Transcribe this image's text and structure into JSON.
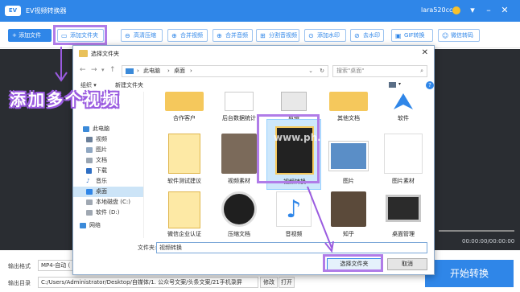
{
  "app": {
    "title": "EV视频转换器",
    "logo": "EV",
    "username": "lara520cc",
    "accent_color": "#2f86e8"
  },
  "toolbar": {
    "add_file": "+ 添加文件",
    "add_folder": "添加文件夹",
    "buttons": [
      "高清压缩",
      "合并视频",
      "合并音频",
      "分割音视频",
      "添加水印",
      "去水印",
      "GIF转换",
      "微信转码"
    ]
  },
  "player": {
    "time": "00:00:00/00:00:00"
  },
  "bottom": {
    "format_label": "输出格式",
    "format_value": "MP4-自动 (",
    "dir_label": "输出目录",
    "dir_value": "C:/Users/Administrator/Desktop/自媒体/1. 公众号文案/头条文案/21手机录屏",
    "modify": "修改",
    "open": "打开",
    "start": "开始转换"
  },
  "dialog": {
    "title": "选择文件夹",
    "crumbs": [
      "此电脑",
      "桌面"
    ],
    "search_placeholder": "搜索\"桌面\"",
    "organize": "组织 ▾",
    "new_folder": "新建文件夹",
    "nav_items": [
      {
        "label": "此电脑"
      },
      {
        "label": "视频"
      },
      {
        "label": "图片"
      },
      {
        "label": "文档"
      },
      {
        "label": "下载"
      },
      {
        "label": "音乐"
      },
      {
        "label": "桌面"
      },
      {
        "label": "本地磁盘 (C:)"
      },
      {
        "label": "软件 (D:)"
      },
      {
        "label": "网络"
      }
    ],
    "files": [
      {
        "label": "合作客户"
      },
      {
        "label": "后台数据统计"
      },
      {
        "label": "剪辑"
      },
      {
        "label": "其他文档"
      },
      {
        "label": "软件"
      },
      {
        "label": "软件测试建议"
      },
      {
        "label": "视频素材"
      },
      {
        "label": "视频转换"
      },
      {
        "label": "图片"
      },
      {
        "label": "图片素材"
      },
      {
        "label": "微信企业认证"
      },
      {
        "label": "压缩文档"
      },
      {
        "label": "音视频"
      },
      {
        "label": "知乎"
      },
      {
        "label": "桌面管理"
      }
    ],
    "filename_label": "文件夹:",
    "filename_value": "视频转换",
    "select_button": "选择文件夹",
    "cancel_button": "取消"
  },
  "overlay": {
    "caption": "添加多个视频",
    "watermark": "www.ph...NET"
  }
}
